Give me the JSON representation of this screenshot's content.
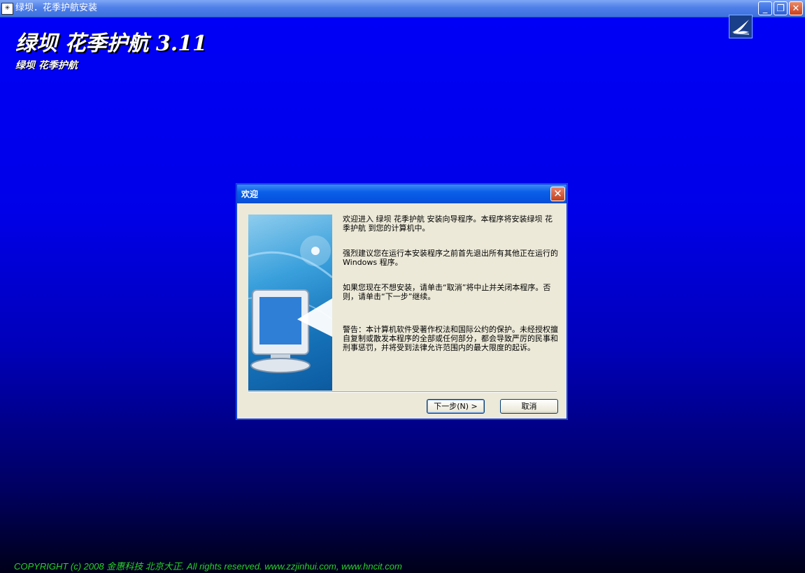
{
  "window": {
    "title": "绿坝．花季护航安装",
    "minimize_symbol": "_",
    "restore_symbol": "❐",
    "close_symbol": "✕"
  },
  "desktop": {
    "big_title": "绿坝 花季护航 3.11",
    "sub_title": "绿坝 花季护航",
    "copyright": "COPYRIGHT (c) 2008 金惠科技 北京大正. All rights reserved. www.zzjinhui.com, www.hncit.com"
  },
  "dialog": {
    "title": "欢迎",
    "paragraphs": [
      "欢迎进入 绿坝 花季护航 安装向导程序。本程序将安装绿坝 花季护航 到您的计算机中。",
      "强烈建议您在运行本安装程序之前首先退出所有其他正在运行的 Windows 程序。",
      "如果您现在不想安装，请单击“取消”将中止并关闭本程序。否则，请单击“下一步”继续。",
      "警告：本计算机软件受著作权法和国际公约的保护。未经授权擅自复制或散发本程序的全部或任何部分，都会导致严厉的民事和刑事惩罚，并将受到法律允许范围内的最大限度的起诉。"
    ],
    "next_button": "下一步(N) >",
    "cancel_button": "取消"
  }
}
